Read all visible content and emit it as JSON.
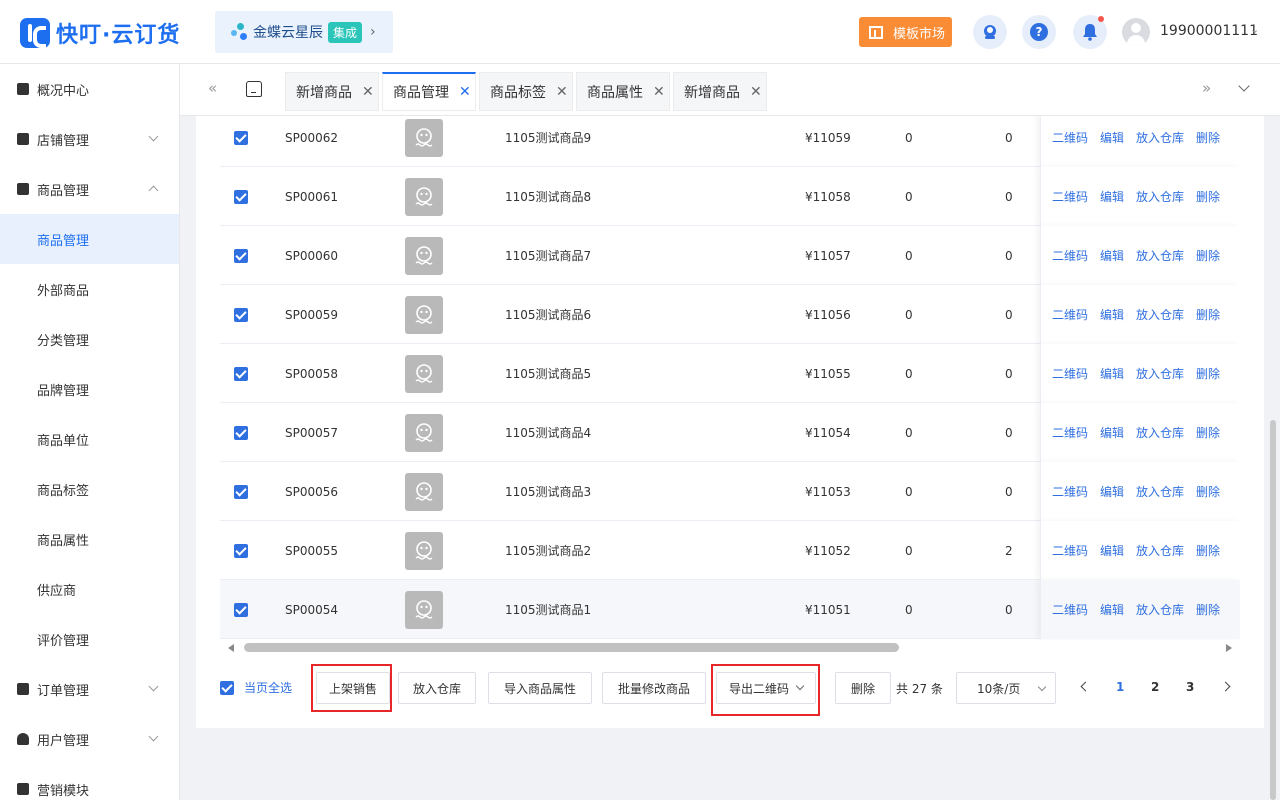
{
  "brand": {
    "name": "快叮·云订货",
    "color": "#1e6ff0"
  },
  "partner": {
    "name": "金蝶云星辰",
    "badge": "集成"
  },
  "header": {
    "market_label": "模板市场",
    "help_glyph": "?",
    "username": "19900001111"
  },
  "sidebar": {
    "items": [
      {
        "label": "概况中心",
        "icon": "dashboard-icon"
      },
      {
        "label": "店铺管理",
        "icon": "store-icon"
      },
      {
        "label": "商品管理",
        "icon": "briefcase-icon"
      },
      {
        "label": "商品管理"
      },
      {
        "label": "外部商品"
      },
      {
        "label": "分类管理"
      },
      {
        "label": "品牌管理"
      },
      {
        "label": "商品单位"
      },
      {
        "label": "商品标签"
      },
      {
        "label": "商品属性"
      },
      {
        "label": "供应商"
      },
      {
        "label": "评价管理"
      },
      {
        "label": "订单管理",
        "icon": "clipboard-icon"
      },
      {
        "label": "用户管理",
        "icon": "user-icon"
      },
      {
        "label": "营销模块",
        "icon": "chart-icon"
      }
    ]
  },
  "tabs": [
    {
      "label": "新增商品"
    },
    {
      "label": "商品管理"
    },
    {
      "label": "商品标签"
    },
    {
      "label": "商品属性"
    },
    {
      "label": "新增商品"
    }
  ],
  "table": {
    "rows": [
      {
        "code": "SP00062",
        "name": "1105测试商品9",
        "price": "¥11059",
        "c1": "0",
        "c2": "0"
      },
      {
        "code": "SP00061",
        "name": "1105测试商品8",
        "price": "¥11058",
        "c1": "0",
        "c2": "0"
      },
      {
        "code": "SP00060",
        "name": "1105测试商品7",
        "price": "¥11057",
        "c1": "0",
        "c2": "0"
      },
      {
        "code": "SP00059",
        "name": "1105测试商品6",
        "price": "¥11056",
        "c1": "0",
        "c2": "0"
      },
      {
        "code": "SP00058",
        "name": "1105测试商品5",
        "price": "¥11055",
        "c1": "0",
        "c2": "0"
      },
      {
        "code": "SP00057",
        "name": "1105测试商品4",
        "price": "¥11054",
        "c1": "0",
        "c2": "0"
      },
      {
        "code": "SP00056",
        "name": "1105测试商品3",
        "price": "¥11053",
        "c1": "0",
        "c2": "0"
      },
      {
        "code": "SP00055",
        "name": "1105测试商品2",
        "price": "¥11052",
        "c1": "0",
        "c2": "2"
      },
      {
        "code": "SP00054",
        "name": "1105测试商品1",
        "price": "¥11051",
        "c1": "0",
        "c2": "0"
      }
    ],
    "actions": [
      "二维码",
      "编辑",
      "放入仓库",
      "删除"
    ]
  },
  "footer": {
    "select_page_label": "当页全选",
    "buttons": [
      "上架销售",
      "放入仓库",
      "导入商品属性",
      "批量修改商品",
      "导出二维码",
      "删除"
    ],
    "total": "共 27 条",
    "page_size": "10条/页",
    "pages": [
      "1",
      "2",
      "3"
    ]
  }
}
